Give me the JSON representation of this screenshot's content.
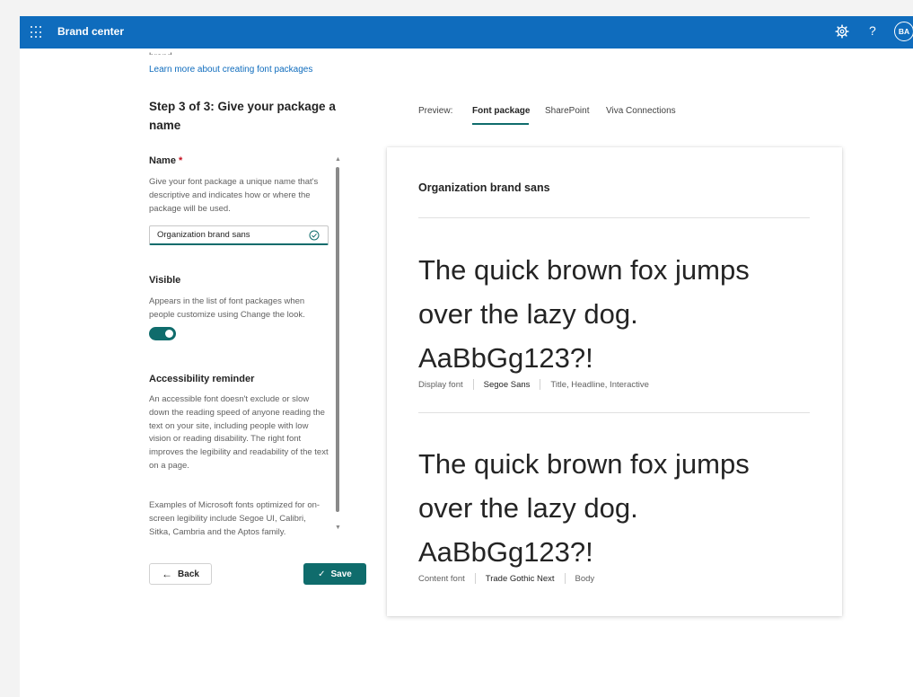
{
  "app": {
    "title": "Brand center",
    "avatar_initials": "BA",
    "help_glyph": "?"
  },
  "icons": {
    "waffle": "app-launcher-icon",
    "settings": "gear-icon",
    "help": "help-icon",
    "valid": "checkmark-circle-icon",
    "back": "arrow-left-icon",
    "save": "checkmark-icon"
  },
  "left": {
    "clipped_text": "brand.",
    "learn_more": "Learn more about creating font packages",
    "step_title": "Step 3 of 3: Give your package a name",
    "name": {
      "label": "Name",
      "required_marker": "*",
      "description": "Give your font package a unique name that's descriptive and indicates how or where the package will be used.",
      "value": "Organization brand sans"
    },
    "visible": {
      "label": "Visible",
      "description": "Appears in the list of font packages when people customize using Change the look.",
      "toggle_on": true
    },
    "accessibility": {
      "label": "Accessibility reminder",
      "description": "An accessible font doesn't exclude or slow down the reading speed of anyone reading the text on your site, including people with low vision or reading disability. The right font improves the legibility and readability of the text on a page.",
      "examples": "Examples of Microsoft fonts optimized for on-screen legibility include Segoe UI, Calibri, Sitka, Cambria and the Aptos family."
    },
    "back_label": "Back",
    "save_label": "Save"
  },
  "preview": {
    "label": "Preview:",
    "tabs": [
      {
        "label": "Font package",
        "active": true
      },
      {
        "label": "SharePoint",
        "active": false
      },
      {
        "label": "Viva Connections",
        "active": false
      }
    ],
    "card": {
      "title": "Organization brand sans",
      "display": {
        "sample_line1": "The quick brown fox jumps",
        "sample_line2": "over the lazy dog.",
        "sample_line3": "AaBbGg123?!",
        "role": "Display font",
        "font": "Segoe Sans",
        "usage": "Title, Headline, Interactive"
      },
      "content": {
        "sample_line1": "The quick brown fox jumps",
        "sample_line2": "over the lazy dog.",
        "sample_line3": "AaBbGg123?!",
        "role": "Content font",
        "font": "Trade Gothic Next",
        "usage": "Body"
      }
    }
  },
  "colors": {
    "header": "#0f6cbd",
    "accent": "#0f6c6c",
    "required": "#c50f1f"
  }
}
